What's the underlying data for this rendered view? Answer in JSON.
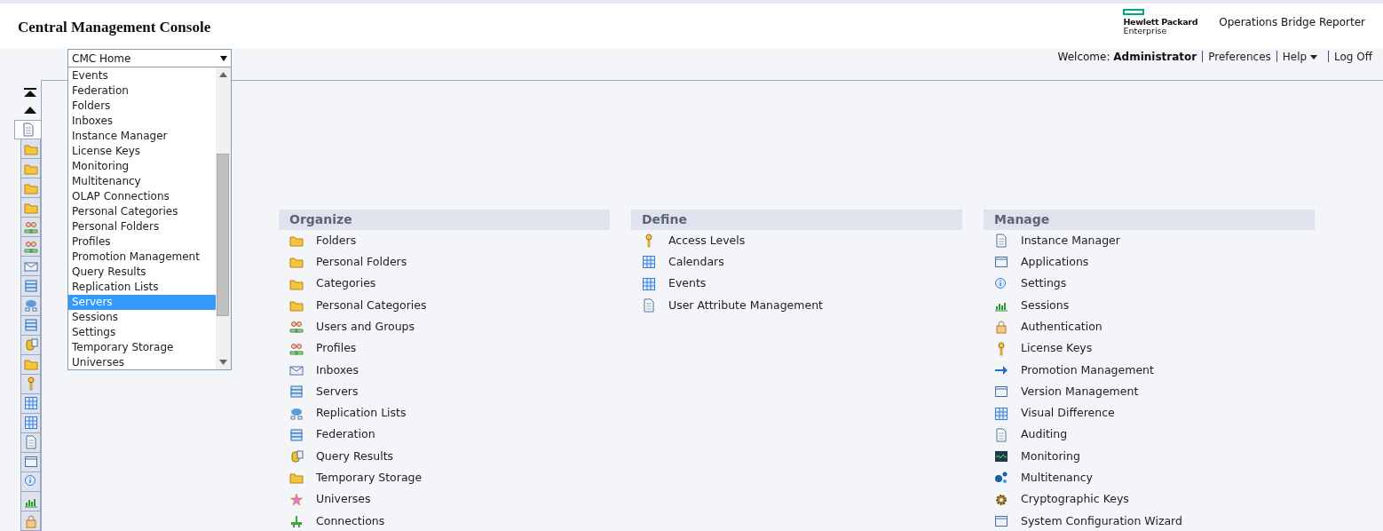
{
  "header": {
    "title": "Central Management Console",
    "brand_line_1": "Hewlett Packard",
    "brand_line_2": "Enterprise",
    "product": "Operations Bridge Reporter"
  },
  "user_bar": {
    "welcome": "Welcome:",
    "user": "Administrator",
    "links": [
      "Preferences",
      "Help",
      "Log Off"
    ]
  },
  "nav_select": {
    "value": "CMC Home",
    "options": [
      {
        "label": "Events",
        "selected": false
      },
      {
        "label": "Federation",
        "selected": false
      },
      {
        "label": "Folders",
        "selected": false
      },
      {
        "label": "Inboxes",
        "selected": false
      },
      {
        "label": "Instance Manager",
        "selected": false
      },
      {
        "label": "License Keys",
        "selected": false
      },
      {
        "label": "Monitoring",
        "selected": false
      },
      {
        "label": "Multitenancy",
        "selected": false
      },
      {
        "label": "OLAP Connections",
        "selected": false
      },
      {
        "label": "Personal Categories",
        "selected": false
      },
      {
        "label": "Personal Folders",
        "selected": false
      },
      {
        "label": "Profiles",
        "selected": false
      },
      {
        "label": "Promotion Management",
        "selected": false
      },
      {
        "label": "Query Results",
        "selected": false
      },
      {
        "label": "Replication Lists",
        "selected": false
      },
      {
        "label": "Servers",
        "selected": true
      },
      {
        "label": "Sessions",
        "selected": false
      },
      {
        "label": "Settings",
        "selected": false
      },
      {
        "label": "Temporary Storage",
        "selected": false
      },
      {
        "label": "Universes",
        "selected": false
      }
    ]
  },
  "sidebar": {
    "tabs": [
      {
        "selected": true
      },
      {
        "selected": false
      },
      {
        "selected": false
      },
      {
        "selected": false
      },
      {
        "selected": false
      },
      {
        "selected": false
      },
      {
        "selected": false
      },
      {
        "selected": false
      },
      {
        "selected": false
      },
      {
        "selected": false
      },
      {
        "selected": false
      },
      {
        "selected": false
      },
      {
        "selected": false
      },
      {
        "selected": false
      },
      {
        "selected": false
      },
      {
        "selected": false
      },
      {
        "selected": false
      },
      {
        "selected": false
      },
      {
        "selected": false
      },
      {
        "selected": false
      },
      {
        "selected": false
      }
    ]
  },
  "sections": [
    {
      "title": "Organize",
      "items": [
        "Folders",
        "Personal Folders",
        "Categories",
        "Personal Categories",
        "Users and Groups",
        "Profiles",
        "Inboxes",
        "Servers",
        "Replication Lists",
        "Federation",
        "Query Results",
        "Temporary Storage",
        "Universes",
        "Connections"
      ]
    },
    {
      "title": "Define",
      "items": [
        "Access Levels",
        "Calendars",
        "Events",
        "User Attribute Management"
      ]
    },
    {
      "title": "Manage",
      "items": [
        "Instance Manager",
        "Applications",
        "Settings",
        "Sessions",
        "Authentication",
        "License Keys",
        "Promotion Management",
        "Version Management",
        "Visual Difference",
        "Auditing",
        "Monitoring",
        "Multitenancy",
        "Cryptographic Keys",
        "System Configuration Wizard"
      ]
    }
  ]
}
